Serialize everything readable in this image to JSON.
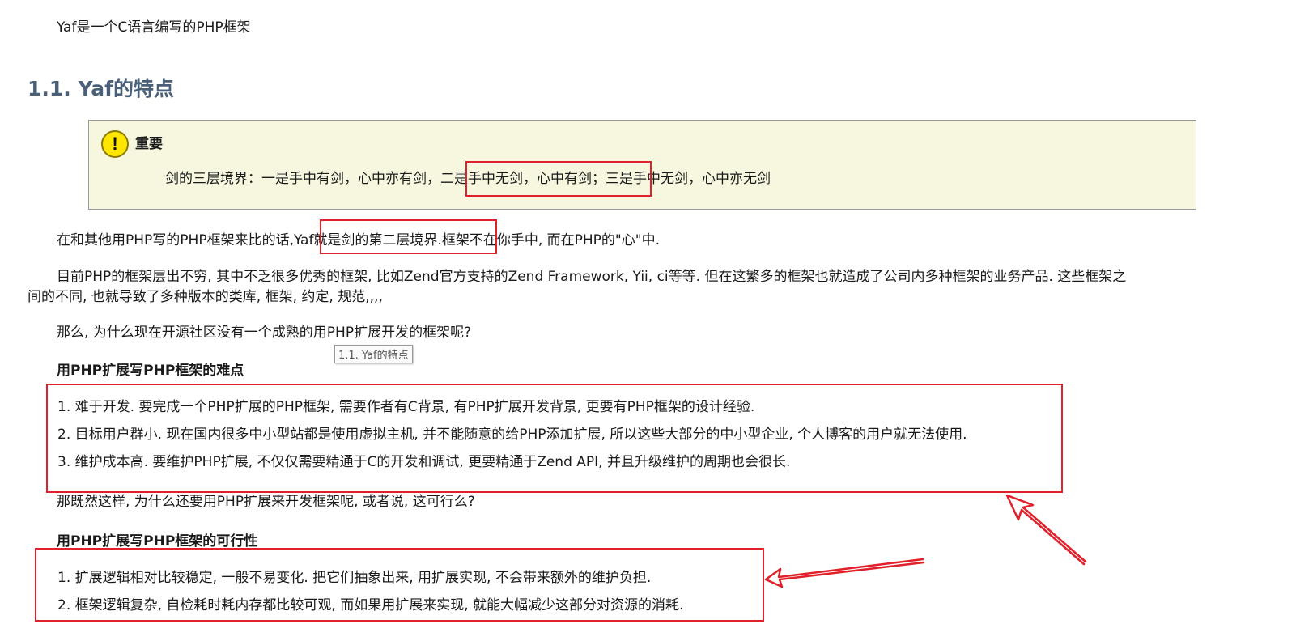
{
  "intro": "Yaf是一个C语言编写的PHP框架",
  "section_heading": "1.1. Yaf的特点",
  "note": {
    "title": "重要",
    "icon": "exclamation-icon",
    "text_part1": "剑的三层境界：一是手中有剑，心中亦有剑，",
    "text_highlight": "二是手中无剑，心中有剑；",
    "text_part3": "三是手中无剑，心中亦无剑"
  },
  "para1": {
    "before": "在和其他用PHP写的PHP框架来比的话,",
    "highlight": "Yaf就是剑的第二层境界.",
    "after": "框架不在你手中, 而在PHP的\"心\"中."
  },
  "para2_line1": "目前PHP的框架层出不穷, 其中不乏很多优秀的框架, 比如Zend官方支持的Zend Framework, Yii, ci等等. 但在这繁多的框架也就造成了公司内多种框架的业务产品. 这些框架之",
  "para2_line2": "间的不同, 也就导致了多种版本的类库, 框架, 约定, 规范,,,,",
  "para3": "那么, 为什么现在开源社区没有一个成熟的用PHP扩展开发的框架呢?",
  "difficulties": {
    "heading": "用PHP扩展写PHP框架的难点",
    "items": [
      "1. 难于开发. 要完成一个PHP扩展的PHP框架, 需要作者有C背景, 有PHP扩展开发背景, 更要有PHP框架的设计经验.",
      "2. 目标用户群小. 现在国内很多中小型站都是使用虚拟主机, 并不能随意的给PHP添加扩展, 所以这些大部分的中小型企业, 个人博客的用户就无法使用.",
      "3. 维护成本高. 要维护PHP扩展, 不仅仅需要精通于C的开发和调试, 更要精通于Zend API, 并且升级维护的周期也会很长."
    ]
  },
  "para4": "那既然这样, 为什么还要用PHP扩展来开发框架呢, 或者说, 这可行么?",
  "feasibility": {
    "heading": "用PHP扩展写PHP框架的可行性",
    "items": [
      "1. 扩展逻辑相对比较稳定, 一般不易变化. 把它们抽象出来, 用扩展实现, 不会带来额外的维护负担.",
      "2. 框架逻辑复杂, 自检耗时耗内存都比较可观, 而如果用扩展来实现, 就能大幅减少这部分对资源的消耗."
    ]
  },
  "tooltip": "1.1. Yaf的特点",
  "colors": {
    "heading": "#4a5f78",
    "annotation_red": "#e0202a",
    "note_bg": "#f7f7df",
    "warn_yellow": "#ffe600"
  }
}
